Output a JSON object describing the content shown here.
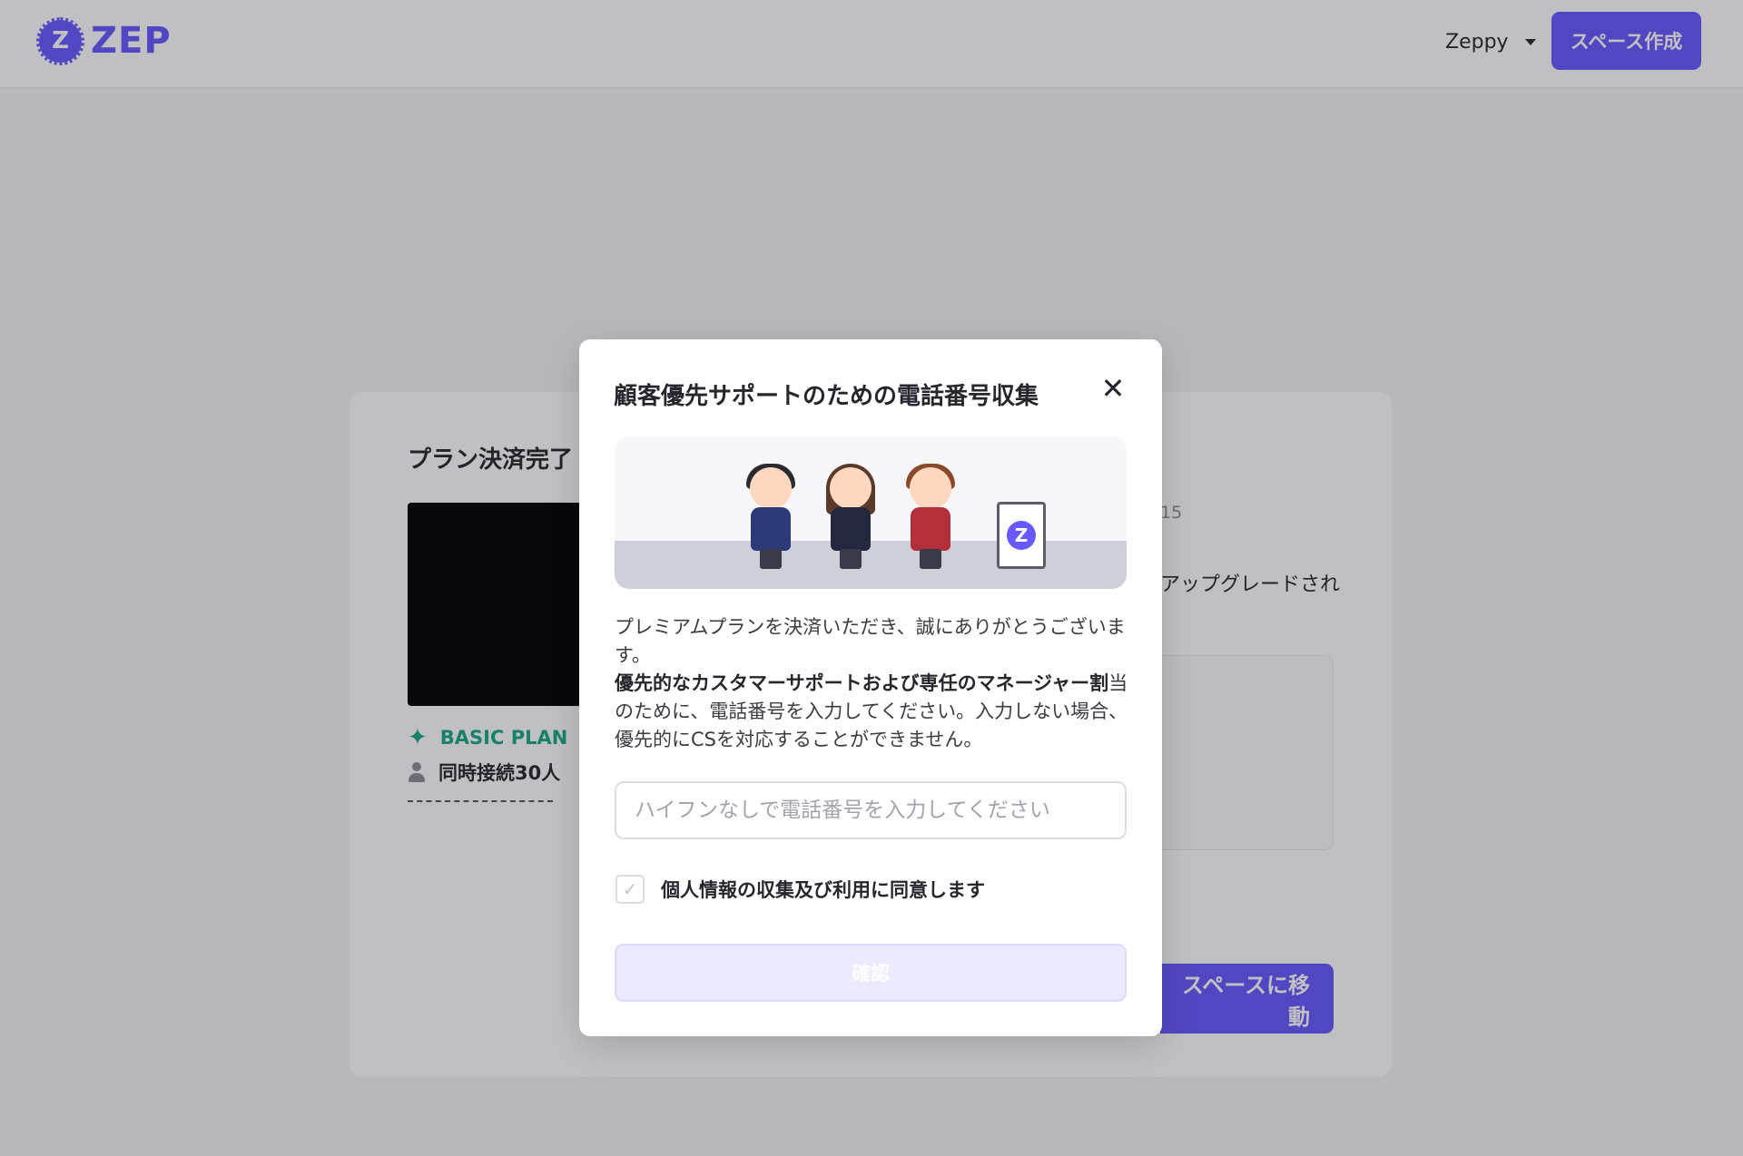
{
  "header": {
    "logo_letter": "Z",
    "logo_text": "ZEP",
    "user_name": "Zeppy",
    "create_space_label": "スペース作成"
  },
  "card": {
    "title": "プラン決済完了",
    "plan_name": "BASIC PLAN",
    "concurrent_users": "同時接続30人",
    "date_partial": "15",
    "upgrade_partial": "アップグレードされ",
    "goto_space_label": "スペースに移動"
  },
  "modal": {
    "title": "顧客優先サポートのための電話番号収集",
    "close_label": "✕",
    "sign_letter": "Z",
    "desc_line1": "プレミアムプランを決済いただき、誠にありがとうございます。",
    "desc_bold": "優先的なカスタマーサポートおよび専任のマネージャー割",
    "desc_line3": "当のために、電話番号を入力してください。入力しない場合、優先的にCSを対応することができません。",
    "phone_placeholder": "ハイフンなしで電話番号を入力してください",
    "phone_value": "",
    "agree_label": "個人情報の収集及び利用に同意します",
    "checkmark": "✓",
    "confirm_label": "確認"
  },
  "colors": {
    "brand": "#6758ff",
    "plan_green": "#17a884"
  }
}
